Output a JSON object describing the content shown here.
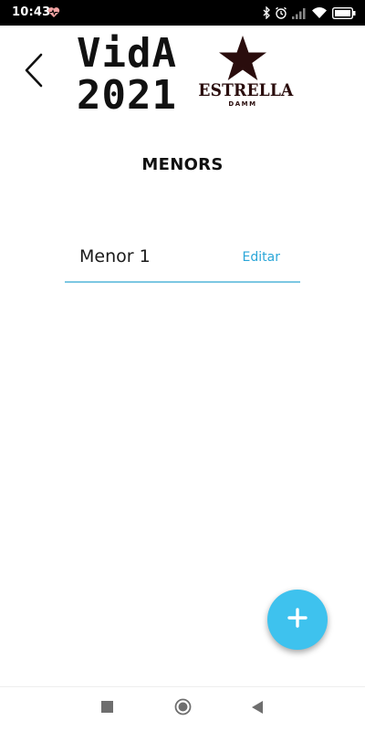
{
  "status_bar": {
    "time": "10:43",
    "icons": [
      "heart-rate-icon",
      "bluetooth-icon",
      "alarm-icon",
      "signal-icon",
      "wifi-icon",
      "battery-icon"
    ]
  },
  "header": {
    "back_icon": "chevron-left-icon",
    "brand_line1": "VidA",
    "brand_line2": "2021",
    "sponsor_name": "ESTRELLA",
    "sponsor_sub": "DAMM",
    "sponsor_icon": "star-icon",
    "sponsor_color": "#2a0d0d"
  },
  "page_title": "MENORS",
  "items": [
    {
      "name": "Menor 1",
      "action": "Editar"
    }
  ],
  "fab": {
    "icon": "plus-icon",
    "color": "#3ec2ee"
  },
  "accent_color": "#2aa6d8",
  "nav_bar": {
    "icons": [
      "recent-apps-icon",
      "home-icon",
      "back-icon"
    ]
  }
}
